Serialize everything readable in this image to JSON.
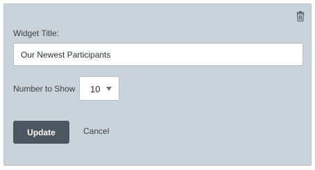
{
  "widget": {
    "title_label": "Widget Title:",
    "title_value": "Our Newest Participants",
    "count_label": "Number to Show",
    "count_value": "10",
    "update_label": "Update",
    "cancel_label": "Cancel",
    "delete_icon": "trash-icon"
  },
  "colors": {
    "panel_bg": "#cad3da",
    "primary_button": "#4c5660",
    "text": "#3a3f44"
  }
}
